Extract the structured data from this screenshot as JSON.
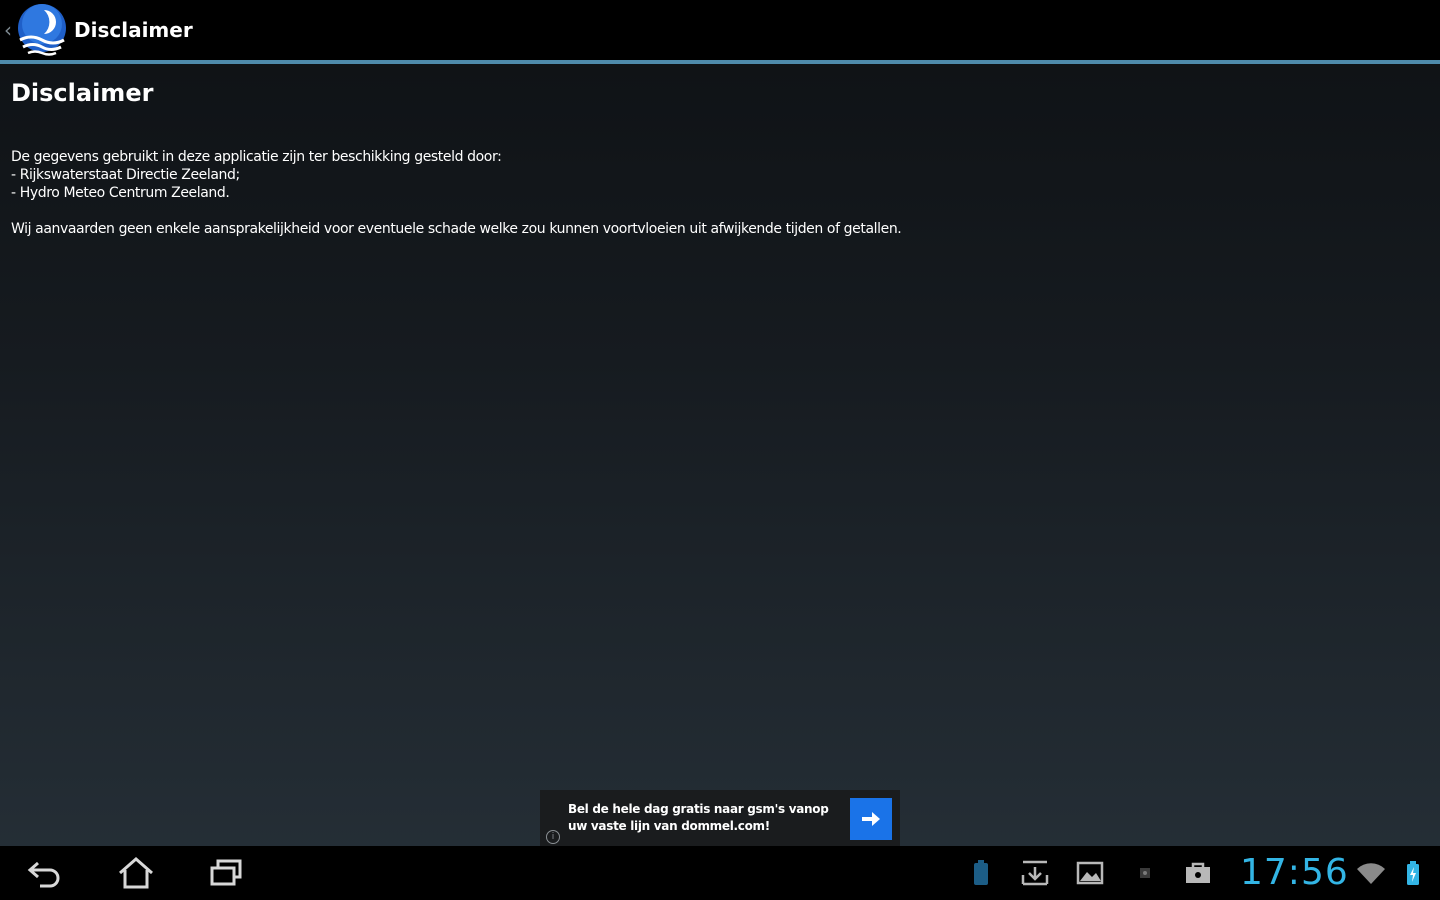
{
  "app": {
    "title": "Disclaimer",
    "logo_icon": "moon-wave-logo-icon",
    "accent_color": "#4f8bab"
  },
  "content": {
    "heading": "Disclaimer",
    "paragraph_1": "De gegevens gebruikt in deze applicatie zijn ter beschikking gesteld door:\n- Rijkswaterstaat Directie Zeeland;\n- Hydro Meteo Centrum Zeeland.",
    "paragraph_2": "Wij aanvaarden geen enkele aansprakelijkheid voor eventuele schade welke zou kunnen voortvloeien uit afwijkende tijden of getallen."
  },
  "ad": {
    "text": "Bel de hele dag gratis naar gsm's vanop uw vaste lijn van dommel.com!",
    "info_glyph": "i",
    "arrow_color": "#1a73e8"
  },
  "system_bar": {
    "nav": [
      "back-icon",
      "home-icon",
      "recent-apps-icon"
    ],
    "status_icons": [
      "battery-notification-icon",
      "download-icon",
      "gallery-icon",
      "small-notification-icon",
      "store-icon",
      "wifi-icon",
      "battery-icon"
    ],
    "clock": "17:56",
    "clock_color": "#33b5e5"
  }
}
